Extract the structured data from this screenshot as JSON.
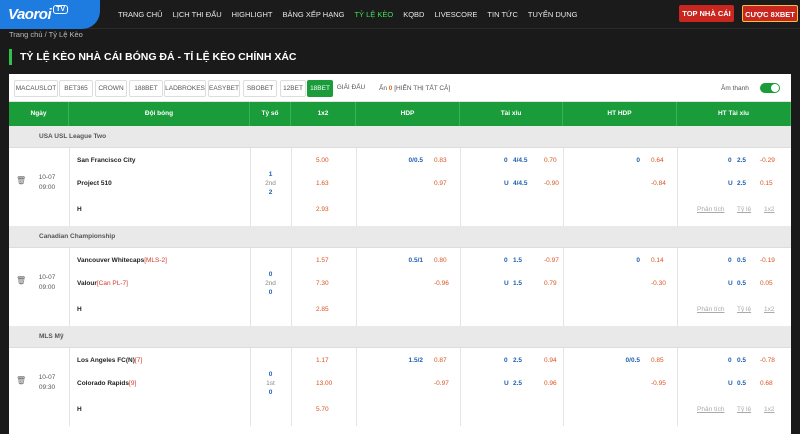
{
  "brand": {
    "logo_text": "Vaoroi",
    "logo_badge": "TV"
  },
  "menu": [
    {
      "label": "TRANG CHỦ",
      "active": false
    },
    {
      "label": "LỊCH THI ĐẤU",
      "active": false
    },
    {
      "label": "HIGHLIGHT",
      "active": false
    },
    {
      "label": "BẢNG XẾP HẠNG",
      "active": false
    },
    {
      "label": "TỶ LỆ KÈO",
      "active": true
    },
    {
      "label": "KQBD",
      "active": false
    },
    {
      "label": "LIVESCORE",
      "active": false
    },
    {
      "label": "TIN TỨC",
      "active": false
    },
    {
      "label": "TUYỂN DỤNG",
      "active": false
    }
  ],
  "header_buttons": {
    "top": "TOP NHÀ CÁI",
    "bet": "CƯỢC 8XBET"
  },
  "breadcrumb": {
    "home": "Trang chủ",
    "sep": "/",
    "current": "Tỷ Lệ Kèo"
  },
  "page_title": "TỶ LỆ KÈO NHÀ CÁI BÓNG ĐÁ - TỈ LỆ KÈO CHÍNH XÁC",
  "bookmakers": [
    "MACAUSLOT",
    "BET365",
    "CROWN",
    "188BET",
    "LADBROKES",
    "EASYBET",
    "SBOBET",
    "12BET",
    "18BET",
    "GIẢI ĐẤU"
  ],
  "active_bookmaker": "18BET",
  "hide": {
    "label": "Ẩn",
    "count": "0",
    "show_all": "[HIỂN THỊ TẤT CẢ]"
  },
  "sound": {
    "label": "Âm thanh",
    "on": true
  },
  "columns": [
    "Ngày",
    "Đội bóng",
    "Tỷ số",
    "1x2",
    "HDP",
    "Tài xỉu",
    "HT HDP",
    "HT Tài xỉu"
  ],
  "links": {
    "analysis": "Phân tích",
    "odds": "Tỷ lệ",
    "x12": "1x2"
  },
  "colors": {
    "accent": "#1a9c3b",
    "header_bg": "#1b1b1b",
    "blue": "#1f5fb0",
    "red": "#d9531e"
  },
  "leagues": [
    {
      "name": "USA USL League Two",
      "match": {
        "date": "10-07",
        "time": "09:00",
        "home": "San Francisco City",
        "home_rank": "",
        "away": "Project 510",
        "away_rank": "",
        "draw": "H",
        "score_home": "1",
        "period": "2nd",
        "score_away": "2",
        "x12": [
          "5.00",
          "1.63",
          "2.93"
        ],
        "hdp": {
          "line": "0/0.5",
          "home": "0.83",
          "away": "0.97"
        },
        "ou": {
          "o_label": "0",
          "line": "4/4.5",
          "over": "0.70",
          "u_label": "U",
          "line2": "4/4.5",
          "under": "-0.90"
        },
        "ht_hdp": {
          "line": "0",
          "home": "0.64",
          "away": "-0.84"
        },
        "ht_ou": {
          "o_label": "0",
          "line": "2.5",
          "over": "-0.29",
          "u_label": "U",
          "line2": "2.5",
          "under": "0.15"
        }
      }
    },
    {
      "name": "Canadian Championship",
      "match": {
        "date": "10-07",
        "time": "09:00",
        "home": "Vancouver Whitecaps",
        "home_rank": "[MLS-2]",
        "away": "Valour",
        "away_rank": "[Can PL-7]",
        "draw": "H",
        "score_home": "0",
        "period": "2nd",
        "score_away": "0",
        "x12": [
          "1.57",
          "7.30",
          "2.85"
        ],
        "hdp": {
          "line": "0.5/1",
          "home": "0.80",
          "away": "-0.96"
        },
        "ou": {
          "o_label": "0",
          "line": "1.5",
          "over": "-0.97",
          "u_label": "U",
          "line2": "1.5",
          "under": "0.79"
        },
        "ht_hdp": {
          "line": "0",
          "home": "0.14",
          "away": "-0.30"
        },
        "ht_ou": {
          "o_label": "0",
          "line": "0.5",
          "over": "-0.19",
          "u_label": "U",
          "line2": "0.5",
          "under": "0.05"
        }
      }
    },
    {
      "name": "MLS Mỹ",
      "match": {
        "date": "10-07",
        "time": "09:30",
        "home": "Los Angeles FC(N)",
        "home_rank": "[7]",
        "away": "Colorado Rapids",
        "away_rank": "[9]",
        "draw": "H",
        "score_home": "0",
        "period": "1st",
        "score_away": "0",
        "x12": [
          "1.17",
          "13.00",
          "5.70"
        ],
        "hdp": {
          "line": "1.5/2",
          "home": "0.87",
          "away": "-0.97"
        },
        "ou": {
          "o_label": "0",
          "line": "2.5",
          "over": "0.94",
          "u_label": "U",
          "line2": "2.5",
          "under": "0.96"
        },
        "ht_hdp": {
          "line": "0/0.5",
          "home": "0.85",
          "away": "-0.95"
        },
        "ht_ou": {
          "o_label": "0",
          "line": "0.5",
          "over": "-0.78",
          "u_label": "U",
          "line2": "0.5",
          "under": "0.68"
        }
      }
    }
  ]
}
